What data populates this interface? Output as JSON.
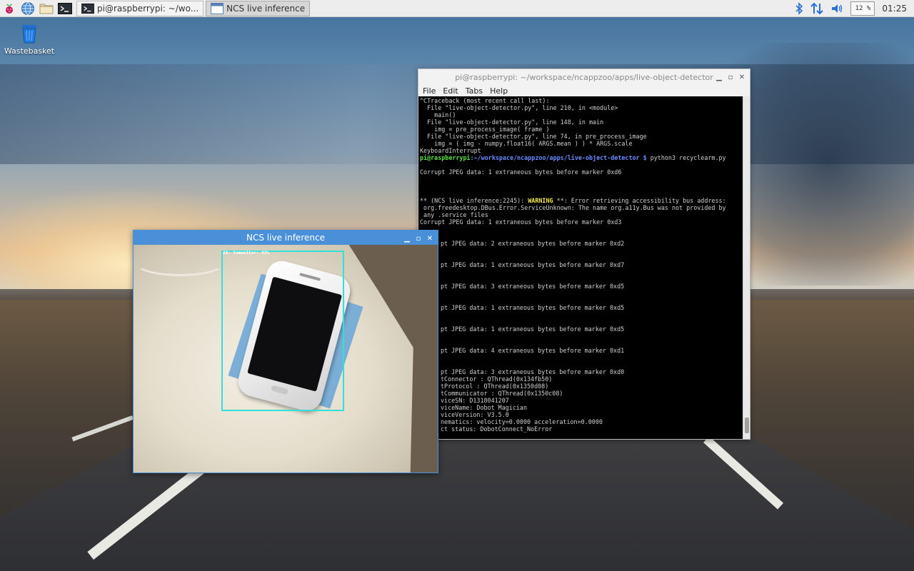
{
  "taskbar": {
    "launchers": [
      {
        "name": "raspberry-menu",
        "icon": "raspberry-icon"
      },
      {
        "name": "web-browser",
        "icon": "globe-icon"
      },
      {
        "name": "file-manager",
        "icon": "folder-icon"
      },
      {
        "name": "terminal",
        "icon": "terminal-icon"
      }
    ],
    "tasks": [
      {
        "label": "pi@raspberrypi: ~/wo...",
        "icon": "terminal-icon",
        "active": false
      },
      {
        "label": "NCS live inference",
        "icon": "window-icon",
        "active": true
      }
    ],
    "cpu_usage": "12 %",
    "clock": "01:25",
    "colors": {
      "bluetooth": "#2a6fd6",
      "network": "#2a6fd6",
      "volume": "#2a6fd6"
    }
  },
  "desktop": {
    "icons": [
      {
        "label": "Wastebasket",
        "icon": "trash-icon"
      }
    ]
  },
  "terminal": {
    "title": "pi@raspberrypi: ~/workspace/ncappzoo/apps/live-object-detector",
    "menu": [
      "File",
      "Edit",
      "Tabs",
      "Help"
    ],
    "lines": [
      "^CTraceback (most recent call last):",
      "  File \"live-object-detector.py\", line 210, in <module>",
      "    main()",
      "  File \"live-object-detector.py\", line 148, in main",
      "    img = pre_process_image( frame )",
      "  File \"live-object-detector.py\", line 74, in pre_process_image",
      "    img = ( img - numpy.float16( ARGS.mean ) ) * ARGS.scale",
      "KeyboardInterrupt"
    ],
    "prompt_user": "pi@raspberrypi",
    "prompt_path": ":~/workspace/ncappzoo/apps/live-object-detector $",
    "prompt_cmd": " python3 recyclearm.py",
    "corrupt_first": "Corrupt JPEG data: 1 extraneous bytes before marker 0xd6",
    "warning_prefix": "** (NCS live inference:2245): ",
    "warning_word": "WARNING",
    "warning_rest": " **: Error retrieving accessibility bus address:",
    "warning_lines": [
      " org.freedesktop.DBus.Error.ServiceUnknown: The name org.a11y.Bus was not provided by",
      " any .service files"
    ],
    "corrupt_second": "Corrupt JPEG data: 1 extraneous bytes before marker 0xd3",
    "partial_lines": [
      "pt JPEG data: 2 extraneous bytes before marker 0xd2",
      "pt JPEG data: 1 extraneous bytes before marker 0xd7",
      "pt JPEG data: 3 extraneous bytes before marker 0xd5",
      "pt JPEG data: 1 extraneous bytes before marker 0xd5",
      "pt JPEG data: 1 extraneous bytes before marker 0xd5",
      "pt JPEG data: 4 extraneous bytes before marker 0xd1",
      "pt JPEG data: 3 extraneous bytes before marker 0xd0"
    ],
    "status_lines": [
      "tConnector : QThread(0x134fb50)",
      "tProtocol : QThread(0x1350d08)",
      "tCommunicator : QThread(0x1350c08)",
      "viceSN: D1318041207",
      "viceName: Dobot Magician",
      "viceVersion: V3.5.0",
      "nematics: velocity=0.0000 acceleration=0.0000",
      "ct status: DobotConnect_NoError"
    ],
    "colors": {
      "prompt_user": "#5ee04a",
      "prompt_path": "#6a8cff",
      "warning": "#f3e64d"
    }
  },
  "ncs_window": {
    "title": "NCS live inference",
    "detection_label": "20: tvmonitor: 93%",
    "colors": {
      "titlebar": "#4a90d9",
      "bbox": "#33e0d8"
    }
  }
}
